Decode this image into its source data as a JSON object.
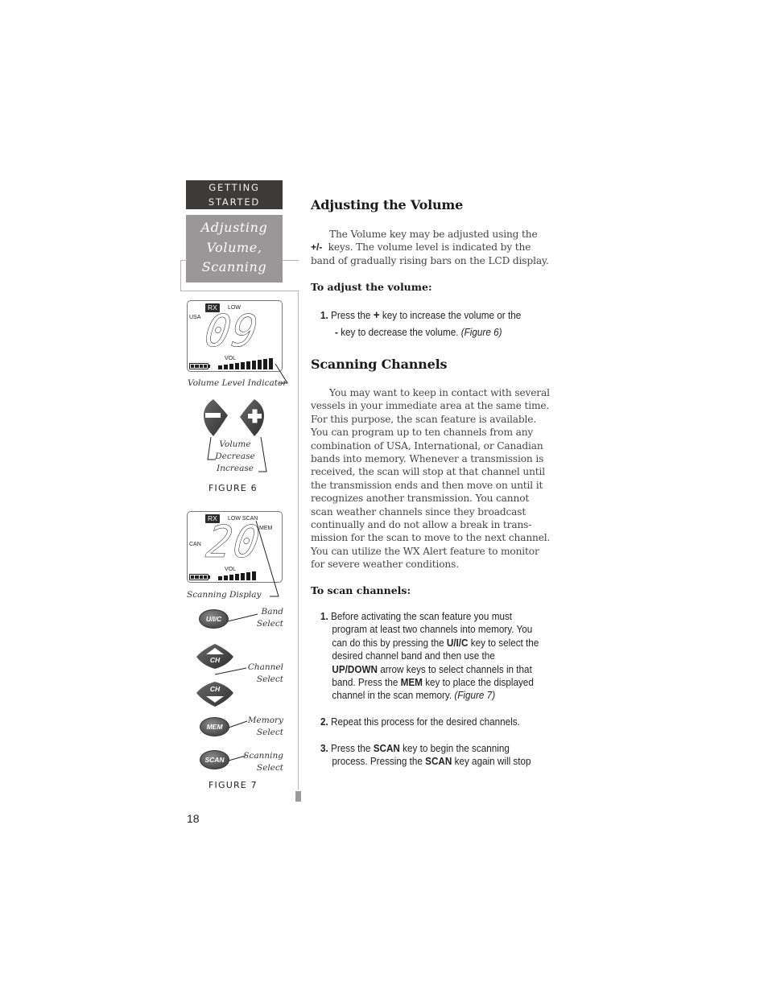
{
  "sidebar": {
    "section_tab": [
      "GETTING",
      "STARTED"
    ],
    "topic": [
      "Adjusting",
      "Volume,",
      "Scanning"
    ]
  },
  "figure6": {
    "lcd": {
      "rx": "RX",
      "power": "LOW",
      "band": "USA",
      "channel": "09",
      "vol_label": "VOL",
      "volume_bars": 10,
      "battery_cells": 4
    },
    "lcd_caption": "Volume Level Indicator",
    "keys": {
      "minus": "−",
      "plus": "+"
    },
    "key_caption": [
      "Volume",
      "Decrease",
      "Increase"
    ],
    "label": "FIGURE 6"
  },
  "figure7": {
    "lcd": {
      "rx": "RX",
      "power": "LOW SCAN",
      "mem": "MEM",
      "band": "CAN",
      "channel": "20",
      "vol_label": "VOL",
      "volume_bars": 7,
      "battery_cells": 4
    },
    "lcd_caption": "Scanning Display",
    "keys": [
      {
        "label": "U/I/C",
        "caption": [
          "Band",
          "Select"
        ]
      },
      {
        "label": "CH",
        "caption": [
          "Channel",
          "Select"
        ]
      },
      {
        "label": "MEM",
        "caption": [
          "Memory",
          "Select"
        ]
      },
      {
        "label": "SCAN",
        "caption": [
          "Scanning",
          "Select"
        ]
      }
    ],
    "ch_up_label": "CH",
    "ch_down_label": "CH",
    "label": "FIGURE 7"
  },
  "main": {
    "volume": {
      "heading": "Adjusting the Volume",
      "para_lines": [
        "The Volume key may be adjusted using the",
        "keys. The volume level is indicated by the",
        "band of gradually rising bars on the LCD display."
      ],
      "plusminus": "+/-",
      "subheading": "To adjust the volume:",
      "step1": {
        "num": "1.",
        "a": "Press the",
        "plus": "+",
        "b": "key to increase the volume or the",
        "minus": "-",
        "c": "key to decrease the volume.",
        "ref": "(Figure 6)"
      }
    },
    "scanning": {
      "heading": "Scanning Channels",
      "para_lines": [
        "You may want to keep in contact with several",
        "vessels in your immediate area at the same time.",
        "For this purpose, the scan feature is available.",
        "You can program up to ten channels from any",
        "combination of USA, International, or Canadian",
        "bands into memory. Whenever a transmission is",
        "received, the scan will stop at that channel until",
        "the transmission ends and then move on until it",
        "recognizes another transmission. You cannot",
        "scan weather channels since they broadcast",
        "continually and do not allow a break in trans-",
        "mission for the scan to move to the next channel.",
        "You can utilize the WX Alert feature to monitor",
        "for severe weather conditions."
      ],
      "subheading": "To scan channels:",
      "steps": [
        {
          "num": "1.",
          "t1": "Before activating the scan feature you must",
          "t2": "program at least two channels into memory. You",
          "t3a": "can do this by pressing the",
          "t3k": "U/I/C",
          "t3b": "key to select the",
          "t4": "desired channel band and then use the",
          "t5k": "UP/DOWN",
          "t5b": "arrow keys to select channels in that",
          "t6a": "band. Press the",
          "t6k": "MEM",
          "t6b": "key to place the displayed",
          "t7": "channel in the scan memory.",
          "ref": "(Figure 7)"
        },
        {
          "num": "2.",
          "t1": "Repeat this process for the desired channels."
        },
        {
          "num": "3.",
          "t1a": "Press the",
          "t1k": "SCAN",
          "t1b": "key to begin the scanning",
          "t2a": "process. Pressing the",
          "t2k": "SCAN",
          "t2b": "key again will stop"
        }
      ]
    }
  },
  "page_number": "18"
}
